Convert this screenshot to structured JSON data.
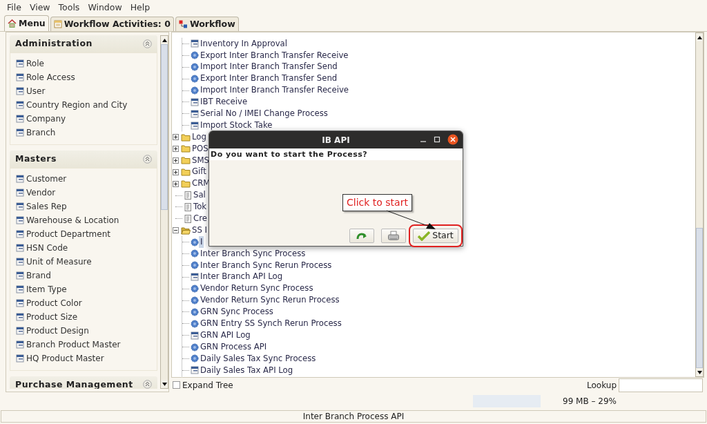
{
  "menu_bar": [
    {
      "label": "File"
    },
    {
      "label": "View"
    },
    {
      "label": "Tools"
    },
    {
      "label": "Window"
    },
    {
      "label": "Help"
    }
  ],
  "tabs": [
    {
      "label": "Menu",
      "kind": "home",
      "selected": true
    },
    {
      "label": "Workflow Activities: 0",
      "kind": "list",
      "selected": false
    },
    {
      "label": "Workflow",
      "kind": "flow",
      "selected": false
    }
  ],
  "sidebar": {
    "sections": [
      {
        "title": "Administration",
        "items": [
          "Role",
          "Role Access",
          "User",
          "Country Region and City",
          "Company",
          "Branch"
        ]
      },
      {
        "title": "Masters",
        "items": [
          "Customer",
          "Vendor",
          "Sales Rep",
          "Warehouse & Location",
          "Product Department",
          "HSN Code",
          "Unit of Measure",
          "Brand",
          "Item Type",
          "Product Color",
          "Product Size",
          "Product Design",
          "Branch Product Master",
          "HQ Product Master"
        ]
      },
      {
        "title": "Purchase Management"
      }
    ]
  },
  "tree": {
    "continued_children": [
      {
        "label": "Inventory In Approval",
        "kind": "form",
        "selected": false
      },
      {
        "label": "Export Inter Branch Transfer Receive",
        "kind": "process",
        "selected": false
      },
      {
        "label": "Import Inter Branch Transfer Send",
        "kind": "process",
        "selected": false
      },
      {
        "label": "Export Inter Branch Transfer Send",
        "kind": "process",
        "selected": false
      },
      {
        "label": "Import Inter Branch Transfer Receive",
        "kind": "process",
        "selected": false
      },
      {
        "label": "IBT Receive",
        "kind": "form",
        "selected": false
      },
      {
        "label": "Serial No / IMEI Change Process",
        "kind": "form",
        "selected": false
      },
      {
        "label": "Import Stock Take",
        "kind": "form",
        "selected": false
      }
    ],
    "nodes": [
      {
        "label": "Log",
        "kind": "folder",
        "expanded": false,
        "selected": false
      },
      {
        "label": "POS",
        "kind": "folder",
        "expanded": false,
        "selected": false
      },
      {
        "label": "SMS",
        "kind": "folder",
        "expanded": false,
        "selected": false
      },
      {
        "label": "Gift",
        "kind": "folder",
        "expanded": false,
        "selected": false
      },
      {
        "label": "CRM",
        "kind": "folder",
        "expanded": false,
        "selected": false
      },
      {
        "label": "Sal",
        "kind": "report",
        "selected": false
      },
      {
        "label": "Tok",
        "kind": "report",
        "selected": false
      },
      {
        "label": "Cre",
        "kind": "report",
        "selected": false
      },
      {
        "label": "SS I",
        "kind": "folder",
        "expanded": true,
        "selected": false,
        "children": [
          {
            "label": "I",
            "kind": "process",
            "selected": true
          },
          {
            "label": "Inter Branch Sync Process",
            "kind": "process",
            "selected": false
          },
          {
            "label": "Inter Branch Sync Rerun Process",
            "kind": "process",
            "selected": false
          },
          {
            "label": "Inter Branch API Log",
            "kind": "form",
            "selected": false
          },
          {
            "label": "Vendor Return Sync Process",
            "kind": "process",
            "selected": false
          },
          {
            "label": "Vendor Return Sync Rerun Process",
            "kind": "process",
            "selected": false
          },
          {
            "label": "GRN Sync Process",
            "kind": "process",
            "selected": false
          },
          {
            "label": "GRN Entry SS Synch Rerun Process",
            "kind": "process",
            "selected": false
          },
          {
            "label": "GRN API Log",
            "kind": "form",
            "selected": false
          },
          {
            "label": "GRN Process API",
            "kind": "process",
            "selected": false
          },
          {
            "label": "Daily Sales Tax Sync Process",
            "kind": "process",
            "selected": false
          },
          {
            "label": "Daily Sales Tax API Log",
            "kind": "form",
            "selected": false
          }
        ]
      }
    ]
  },
  "expand_tree": {
    "label": "Expand Tree",
    "checked": false
  },
  "lookup": {
    "label": "Lookup"
  },
  "memory": "99 MB – 29%",
  "status_bar": "Inter Branch Process API",
  "dialog": {
    "title": "IB API",
    "message": "Do you want to start the Process?",
    "buttons": [
      {
        "kind": "refresh"
      },
      {
        "kind": "print"
      },
      {
        "kind": "start",
        "label": "Start"
      }
    ]
  },
  "annotation": {
    "callout": "Click to start"
  }
}
